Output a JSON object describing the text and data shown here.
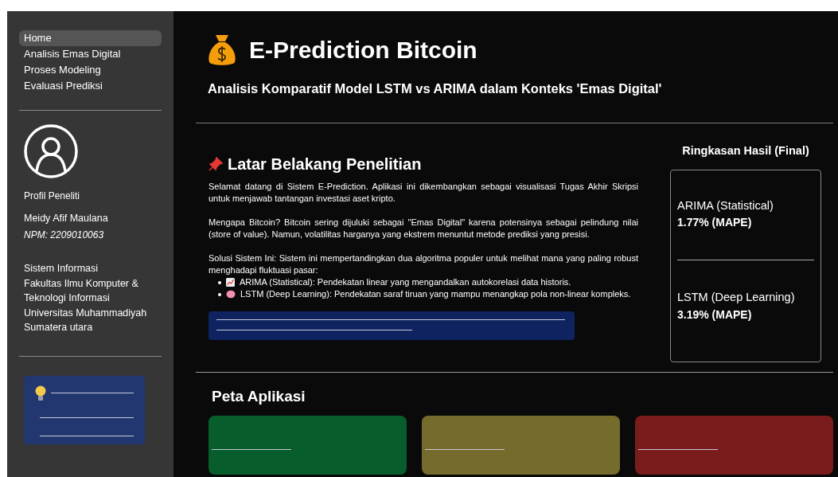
{
  "sidebar": {
    "nav": [
      {
        "label": "Home",
        "selected": true
      },
      {
        "label": "Analisis Emas Digital",
        "selected": false
      },
      {
        "label": "Proses Modeling",
        "selected": false
      },
      {
        "label": "Evaluasi Prediksi",
        "selected": false
      }
    ],
    "profile": {
      "heading": "Profil Peneliti",
      "name": "Meidy Afif Maulana",
      "npm": "NPM: 2209010063",
      "affiliation": [
        "Sistem Informasi",
        "Fakultas Ilmu Komputer & Teknologi Informasi",
        "Universitas Muhammadiyah Sumatera utara"
      ]
    }
  },
  "header": {
    "title": "E-Prediction Bitcoin",
    "subtitle": "Analisis Komparatif Model LSTM vs ARIMA dalam Konteks 'Emas Digital'"
  },
  "background": {
    "heading": "Latar Belakang Penelitian",
    "paragraphs": [
      "Selamat datang di Sistem E-Prediction. Aplikasi ini dikembangkan sebagai visualisasi Tugas Akhir Skripsi untuk menjawab tantangan investasi aset kripto.",
      "Mengapa Bitcoin? Bitcoin sering dijuluki sebagai \"Emas Digital\" karena potensinya sebagai pelindung nilai (store of value). Namun, volatilitas harganya yang ekstrem menuntut metode prediksi yang presisi.",
      "Solusi Sistem Ini: Sistem ini mempertandingkan dua algoritma populer untuk melihat mana yang paling robust menghadapi fluktuasi pasar:"
    ],
    "bullets": [
      {
        "kind": "chart",
        "text": "ARIMA (Statistical): Pendekatan linear yang mengandalkan autokorelasi data historis."
      },
      {
        "kind": "brain",
        "text": "LSTM (Deep Learning): Pendekatan saraf tiruan yang mampu menangkap pola non-linear kompleks."
      }
    ]
  },
  "summary": {
    "heading": "Ringkasan Hasil (Final)",
    "models": [
      {
        "name": "ARIMA (Statistical)",
        "score": "1.77% (MAPE)"
      },
      {
        "name": "LSTM (Deep Learning)",
        "score": "3.19% (MAPE)"
      }
    ]
  },
  "app_map": {
    "heading": "Peta Aplikasi",
    "cards": [
      {
        "color": "#075e2c"
      },
      {
        "color": "#756b2c"
      },
      {
        "color": "#7a1c1c"
      }
    ]
  }
}
